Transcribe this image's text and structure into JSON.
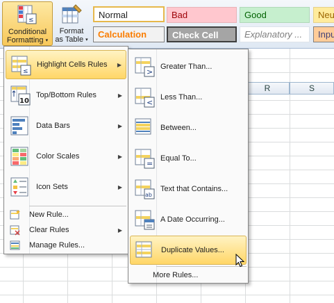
{
  "ribbon": {
    "conditional_formatting": {
      "line1": "Conditional",
      "line2": "Formatting",
      "icon": "conditional-formatting-icon"
    },
    "format_as_table": {
      "line1": "Format",
      "line2": "as Table",
      "icon": "format-as-table-icon"
    },
    "cell_styles": {
      "normal": "Normal",
      "bad": "Bad",
      "good": "Good",
      "neutral": "Neu",
      "calculation": "Calculation",
      "check_cell": "Check Cell",
      "explanatory": "Explanatory ...",
      "input": "Inpu"
    }
  },
  "sheet": {
    "column_headers": [
      "R",
      "S"
    ]
  },
  "main_menu": {
    "items": [
      {
        "label": "Highlight Cells Rules",
        "icon": "highlight-cells-rules-icon",
        "submenu": true,
        "highlighted": true
      },
      {
        "label": "Top/Bottom Rules",
        "icon": "top-bottom-rules-icon",
        "submenu": true
      },
      {
        "label": "Data Bars",
        "icon": "data-bars-icon",
        "submenu": true
      },
      {
        "label": "Color Scales",
        "icon": "color-scales-icon",
        "submenu": true
      },
      {
        "label": "Icon Sets",
        "icon": "icon-sets-icon",
        "submenu": true
      }
    ],
    "small_items": [
      {
        "label": "New Rule...",
        "icon": "new-rule-icon"
      },
      {
        "label": "Clear Rules",
        "icon": "clear-rules-icon",
        "submenu": true
      },
      {
        "label": "Manage Rules...",
        "icon": "manage-rules-icon"
      }
    ]
  },
  "sub_menu": {
    "items": [
      {
        "label": "Greater Than...",
        "icon": "greater-than-icon"
      },
      {
        "label": "Less Than...",
        "icon": "less-than-icon"
      },
      {
        "label": "Between...",
        "icon": "between-icon"
      },
      {
        "label": "Equal To...",
        "icon": "equal-to-icon"
      },
      {
        "label": "Text that Contains...",
        "icon": "text-contains-icon"
      },
      {
        "label": "A Date Occurring...",
        "icon": "date-occurring-icon"
      },
      {
        "label": "Duplicate Values...",
        "icon": "duplicate-values-icon",
        "highlighted": true
      }
    ],
    "more_rules": "More Rules..."
  },
  "colors": {
    "menu_highlight": "#ffd667",
    "ribbon_bg": "#dfe8f3",
    "grid_line": "#dadcdd"
  }
}
